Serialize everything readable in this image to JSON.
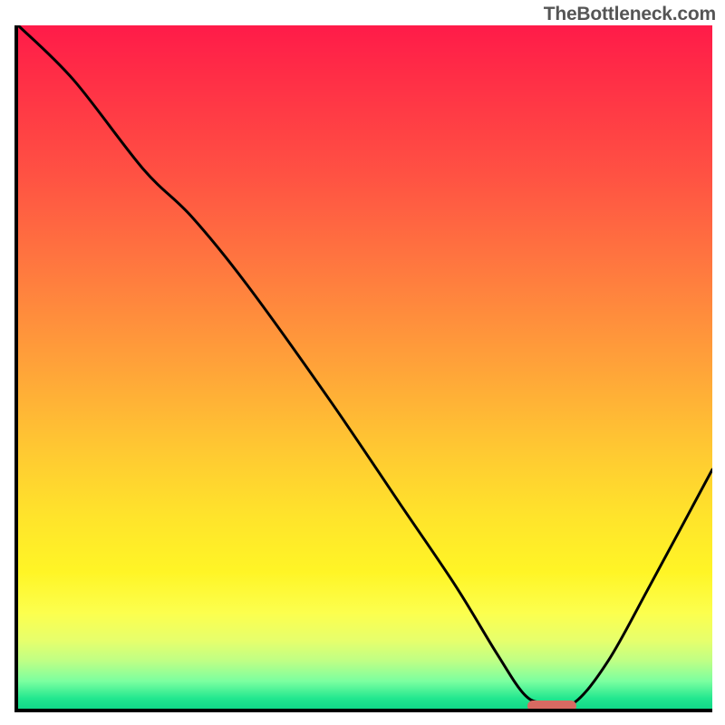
{
  "watermark": "TheBottleneck.com",
  "chart_data": {
    "type": "line",
    "title": "",
    "xlabel": "",
    "ylabel": "",
    "xlim": [
      0,
      100
    ],
    "ylim": [
      0,
      100
    ],
    "grid": false,
    "series": [
      {
        "name": "curve",
        "x": [
          0,
          8,
          18,
          25,
          33,
          45,
          55,
          63,
          69,
          73,
          76,
          80,
          85,
          91,
          100
        ],
        "y": [
          100,
          92,
          79,
          72,
          62,
          45,
          30,
          18,
          8,
          2,
          0.8,
          0.8,
          7,
          18,
          35
        ]
      }
    ],
    "marker": {
      "x_start": 73,
      "x_end": 80,
      "y": 0.9
    },
    "background_gradient": {
      "stops": [
        {
          "pct": 0,
          "color": "#ff1b49"
        },
        {
          "pct": 50,
          "color": "#ffa339"
        },
        {
          "pct": 80,
          "color": "#fff526"
        },
        {
          "pct": 100,
          "color": "#11d989"
        }
      ]
    }
  }
}
